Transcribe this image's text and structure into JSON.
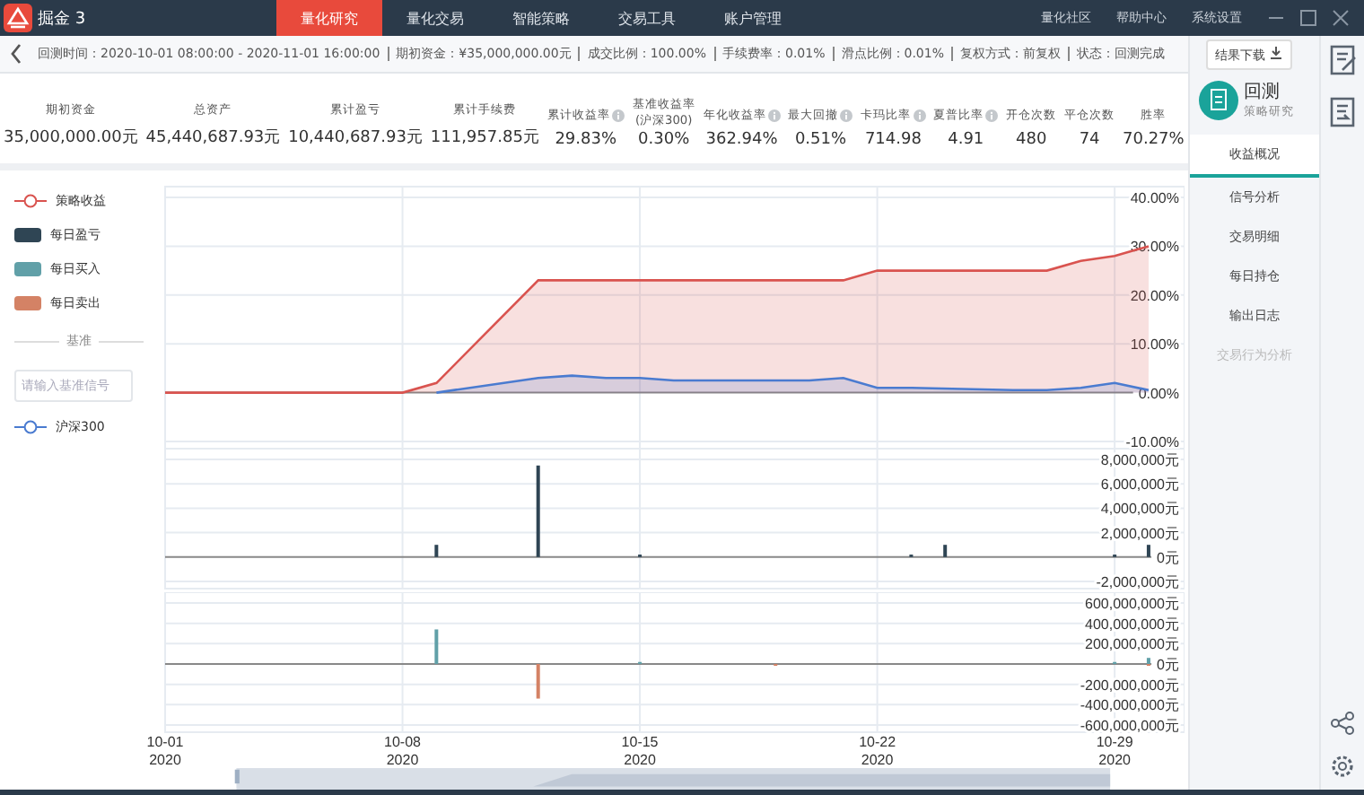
{
  "app": {
    "name": "掘金 3"
  },
  "nav": {
    "items": [
      {
        "label": "量化研究",
        "selected": true
      },
      {
        "label": "量化交易",
        "selected": false
      },
      {
        "label": "智能策略",
        "selected": false
      },
      {
        "label": "交易工具",
        "selected": false
      },
      {
        "label": "账户管理",
        "selected": false
      }
    ],
    "links": [
      "量化社区",
      "帮助中心",
      "系统设置"
    ]
  },
  "info_bar": {
    "items": [
      "回测时间：2020-10-01 08:00:00 - 2020-11-01 16:00:00",
      "期初资金：¥35,000,000.00元",
      "成交比例：100.00%",
      "手续费率：0.01%",
      "滑点比例：0.01%",
      "复权方式：前复权",
      "状态：回测完成"
    ],
    "download_button": "结果下载"
  },
  "stats": [
    {
      "label": "期初资金",
      "value": "35,000,000.00元",
      "info": false
    },
    {
      "label": "总资产",
      "value": "45,440,687.93元",
      "info": false
    },
    {
      "label": "累计盈亏",
      "value": "10,440,687.93元",
      "info": false
    },
    {
      "label": "累计手续费",
      "value": "111,957.85元",
      "info": false
    },
    {
      "label": "累计收益率",
      "value": "29.83%",
      "info": true
    },
    {
      "label": "基准收益率",
      "sublabel": "(沪深300)",
      "value": "0.30%",
      "info": false
    },
    {
      "label": "年化收益率",
      "value": "362.94%",
      "info": true
    },
    {
      "label": "最大回撤",
      "value": "0.51%",
      "info": true
    },
    {
      "label": "卡玛比率",
      "value": "714.98",
      "info": true
    },
    {
      "label": "夏普比率",
      "value": "4.91",
      "info": true
    },
    {
      "label": "开仓次数",
      "value": "480",
      "info": false
    },
    {
      "label": "平仓次数",
      "value": "74",
      "info": false
    },
    {
      "label": "胜率",
      "value": "70.27%",
      "info": false
    }
  ],
  "legend": {
    "items": [
      {
        "kind": "line",
        "label": "策略收益",
        "color": "#d9534f"
      },
      {
        "kind": "swatch",
        "label": "每日盈亏",
        "color": "#2f4554"
      },
      {
        "kind": "swatch",
        "label": "每日买入",
        "color": "#61a0a8"
      },
      {
        "kind": "swatch",
        "label": "每日卖出",
        "color": "#d48265"
      }
    ],
    "benchmark_heading": "基准",
    "benchmark_field": {
      "placeholder": "请输入基准信号"
    },
    "benchmarks": [
      {
        "kind": "line",
        "label": "沪深300",
        "color": "#4a7bd0"
      }
    ]
  },
  "charts": [
    {
      "chart_data": {
        "type": "area",
        "categories": [
          null,
          null,
          null,
          null,
          null,
          null,
          null,
          null,
          null,
          null,
          null,
          null,
          null,
          null,
          null,
          null,
          null,
          null,
          null,
          null,
          null,
          null,
          null,
          null,
          null,
          null,
          null,
          null,
          null,
          null,
          null
        ],
        "ylim": [
          -10,
          40
        ],
        "grid": true,
        "yticks": [
          {
            "value": 40,
            "label": "40.00%"
          },
          {
            "value": 30,
            "label": "30.00%"
          },
          {
            "value": 20,
            "label": "20.00%"
          },
          {
            "value": 10,
            "label": "10.00%"
          },
          {
            "value": 0,
            "label": "0.00%"
          },
          {
            "value": -10,
            "label": "-10.00%"
          }
        ],
        "series": [
          {
            "color": "#d9534f",
            "values": [
              0,
              0,
              0,
              0,
              0,
              0,
              0,
              0,
              2,
              null,
              null,
              23,
              23,
              23,
              23,
              23,
              null,
              null,
              23,
              23,
              23,
              25,
              25,
              null,
              null,
              25,
              25,
              27,
              28,
              30,
              null
            ]
          },
          {
            "color": "#4a7bd0",
            "values": [
              null,
              null,
              null,
              null,
              null,
              null,
              null,
              null,
              0,
              null,
              null,
              3,
              3.5,
              3,
              3,
              2.5,
              null,
              null,
              2.5,
              2.5,
              3,
              1,
              1,
              null,
              null,
              0.5,
              0.5,
              1,
              2,
              0.5,
              null
            ]
          }
        ]
      }
    },
    {
      "chart_data": {
        "type": "bar",
        "categories": [
          null,
          null,
          null,
          null,
          null,
          null,
          null,
          null,
          null,
          null,
          null,
          null,
          null,
          null,
          null,
          null,
          null,
          null,
          null,
          null,
          null,
          null,
          null,
          null,
          null,
          null,
          null,
          null,
          null,
          null,
          null
        ],
        "ylim": [
          -2000000,
          8000000
        ],
        "grid": true,
        "yticks": [
          {
            "value": 8000000,
            "label": "8,000,000元"
          },
          {
            "value": 6000000,
            "label": "6,000,000元"
          },
          {
            "value": 4000000,
            "label": "4,000,000元"
          },
          {
            "value": 2000000,
            "label": "2,000,000元"
          },
          {
            "value": 0,
            "label": "0元"
          },
          {
            "value": -2000000,
            "label": "-2,000,000元"
          }
        ],
        "series": [
          {
            "color": "#2f4554",
            "values": [
              null,
              null,
              null,
              null,
              null,
              null,
              null,
              null,
              1000000,
              null,
              null,
              7500000,
              null,
              null,
              200000,
              null,
              null,
              null,
              null,
              null,
              null,
              null,
              200000,
              1000000,
              null,
              null,
              null,
              null,
              200000,
              1000000,
              null
            ]
          }
        ]
      }
    },
    {
      "chart_data": {
        "type": "bar",
        "categories": [
          "10-01\n2020",
          null,
          null,
          null,
          null,
          null,
          null,
          "10-08\n2020",
          null,
          null,
          null,
          null,
          null,
          null,
          "10-15\n2020",
          null,
          null,
          null,
          null,
          null,
          null,
          "10-22\n2020",
          null,
          null,
          null,
          null,
          null,
          null,
          "10-29\n2020",
          null,
          null
        ],
        "ylim": [
          -600000000,
          600000000
        ],
        "grid": true,
        "yticks": [
          {
            "value": 600000000,
            "label": "600,000,000元"
          },
          {
            "value": 400000000,
            "label": "400,000,000元"
          },
          {
            "value": 200000000,
            "label": "200,000,000元"
          },
          {
            "value": 0,
            "label": "0元"
          },
          {
            "value": -200000000,
            "label": "-200,000,000元"
          },
          {
            "value": -400000000,
            "label": "-400,000,000元"
          },
          {
            "value": -600000000,
            "label": "-600,000,000元"
          }
        ],
        "series": [
          {
            "color": "#61a0a8",
            "values": [
              null,
              null,
              null,
              null,
              null,
              null,
              null,
              null,
              340000000,
              null,
              null,
              null,
              null,
              null,
              20000000,
              null,
              null,
              null,
              null,
              null,
              null,
              null,
              null,
              null,
              null,
              null,
              null,
              null,
              20000000,
              60000000,
              null
            ]
          },
          {
            "color": "#d48265",
            "values": [
              null,
              null,
              null,
              null,
              null,
              null,
              null,
              null,
              null,
              null,
              null,
              -340000000,
              null,
              null,
              null,
              null,
              null,
              null,
              -10000000,
              null,
              null,
              null,
              null,
              null,
              null,
              null,
              null,
              null,
              null,
              -10000000,
              null
            ]
          }
        ]
      }
    }
  ],
  "zoom_slider": {
    "level": 1
  },
  "side_panel": {
    "title": "回测",
    "subtitle": "策略研究",
    "tabs": [
      {
        "label": "收益概况",
        "selected": true,
        "disabled": false
      },
      {
        "label": "信号分析",
        "selected": false,
        "disabled": false
      },
      {
        "label": "交易明细",
        "selected": false,
        "disabled": false
      },
      {
        "label": "每日持仓",
        "selected": false,
        "disabled": false
      },
      {
        "label": "输出日志",
        "selected": false,
        "disabled": false
      },
      {
        "label": "交易行为分析",
        "selected": false,
        "disabled": true
      }
    ]
  }
}
